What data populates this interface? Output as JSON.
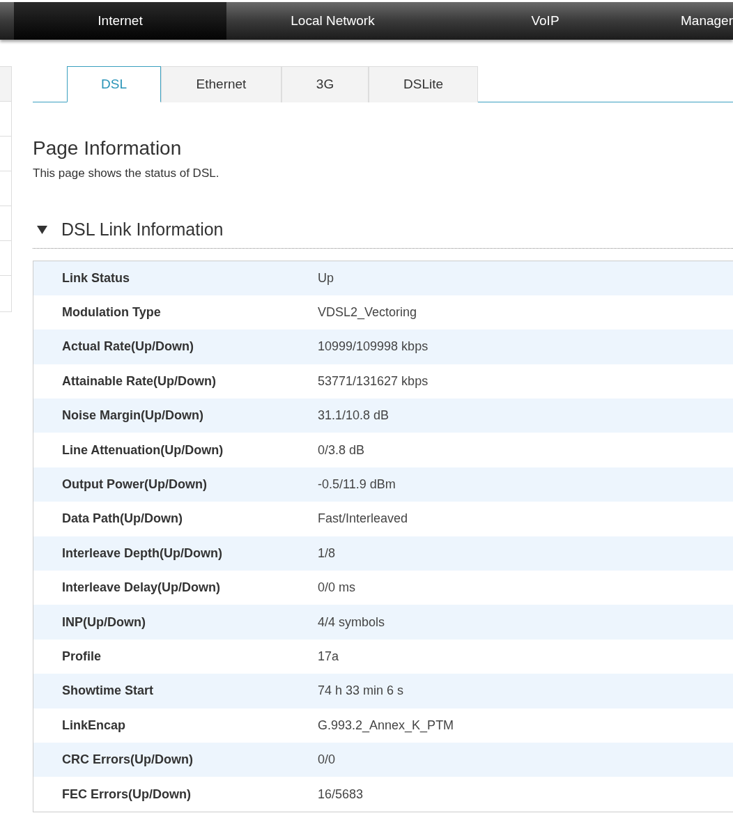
{
  "nav": [
    {
      "label": "Internet",
      "selected": true
    },
    {
      "label": "Local Network",
      "selected": false
    },
    {
      "label": "VoIP",
      "selected": false
    },
    {
      "label": "Manager",
      "selected": false
    }
  ],
  "tabs": [
    {
      "label": "DSL",
      "selected": true
    },
    {
      "label": "Ethernet",
      "selected": false
    },
    {
      "label": "3G",
      "selected": false
    },
    {
      "label": "DSLite",
      "selected": false
    }
  ],
  "page_title": "Page Information",
  "page_description": "This page shows the status of DSL.",
  "section": {
    "title": "DSL Link Information",
    "expanded": true
  },
  "rows": [
    {
      "label": "Link Status",
      "value": "Up"
    },
    {
      "label": "Modulation Type",
      "value": "VDSL2_Vectoring"
    },
    {
      "label": "Actual Rate(Up/Down)",
      "value": "10999/109998 kbps"
    },
    {
      "label": "Attainable Rate(Up/Down)",
      "value": "53771/131627 kbps"
    },
    {
      "label": "Noise Margin(Up/Down)",
      "value": "31.1/10.8 dB"
    },
    {
      "label": "Line Attenuation(Up/Down)",
      "value": "0/3.8 dB"
    },
    {
      "label": "Output Power(Up/Down)",
      "value": "-0.5/11.9 dBm"
    },
    {
      "label": "Data Path(Up/Down)",
      "value": "Fast/Interleaved"
    },
    {
      "label": "Interleave Depth(Up/Down)",
      "value": "1/8"
    },
    {
      "label": "Interleave Delay(Up/Down)",
      "value": "0/0 ms"
    },
    {
      "label": "INP(Up/Down)",
      "value": "4/4 symbols"
    },
    {
      "label": "Profile",
      "value": "17a"
    },
    {
      "label": "Showtime Start",
      "value": "74 h 33 min 6 s"
    },
    {
      "label": "LinkEncap",
      "value": "G.993.2_Annex_K_PTM"
    },
    {
      "label": "CRC Errors(Up/Down)",
      "value": "0/0"
    },
    {
      "label": "FEC Errors(Up/Down)",
      "value": "16/5683"
    }
  ]
}
